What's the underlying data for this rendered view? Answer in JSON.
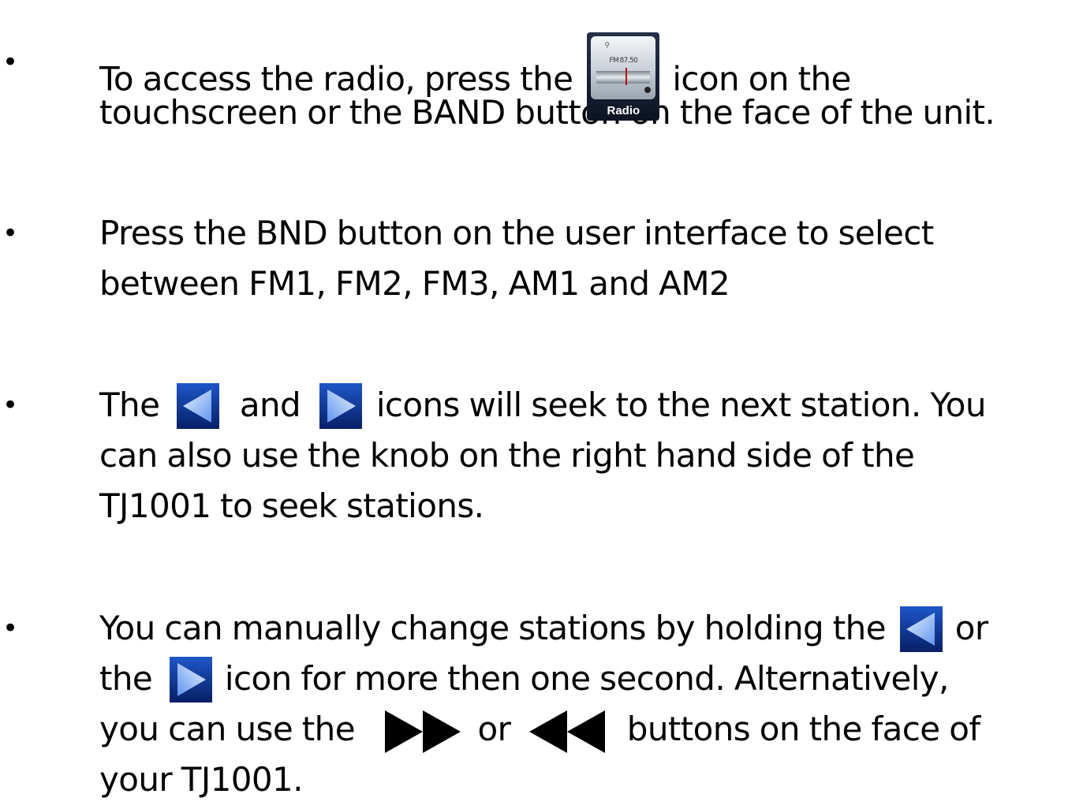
{
  "bullets": [
    {
      "symbol": "•",
      "text": {
        "a": "To access the radio, press the",
        "b": "icon on the",
        "c": "touchscreen or the BAND button on the face of the unit."
      }
    },
    {
      "symbol": "•",
      "text": {
        "a": "Press the BND button on the user interface to select",
        "b": "between FM1, FM2, FM3, AM1 and AM2"
      }
    },
    {
      "symbol": "•",
      "text": {
        "a": "The",
        "b": "and",
        "c": "icons will seek to the next station.   You",
        "d": "can also use the knob on the right hand side of the",
        "e": "TJ1001 to seek stations."
      }
    },
    {
      "symbol": "•",
      "text": {
        "a": "You can manually change stations by holding the",
        "b": "or",
        "c": "the",
        "d": "icon for more then one second.   Alternatively,",
        "e": "you can use the",
        "f": "or",
        "g": "buttons on the face of",
        "h": "your TJ1001."
      }
    }
  ],
  "radio_icon": {
    "frequency": "FM 87.50",
    "label": "Radio",
    "icon": "radio-app-icon"
  },
  "icons": {
    "seek_back": "seek-back-arrow-icon",
    "seek_forward": "seek-forward-arrow-icon",
    "fast_forward": "fast-forward-icon",
    "rewind": "rewind-icon"
  },
  "colors": {
    "text": "#000000",
    "background": "#ffffff",
    "arrow_blue_dark": "#0a2f8c",
    "arrow_blue_light": "#7fb2ff"
  }
}
